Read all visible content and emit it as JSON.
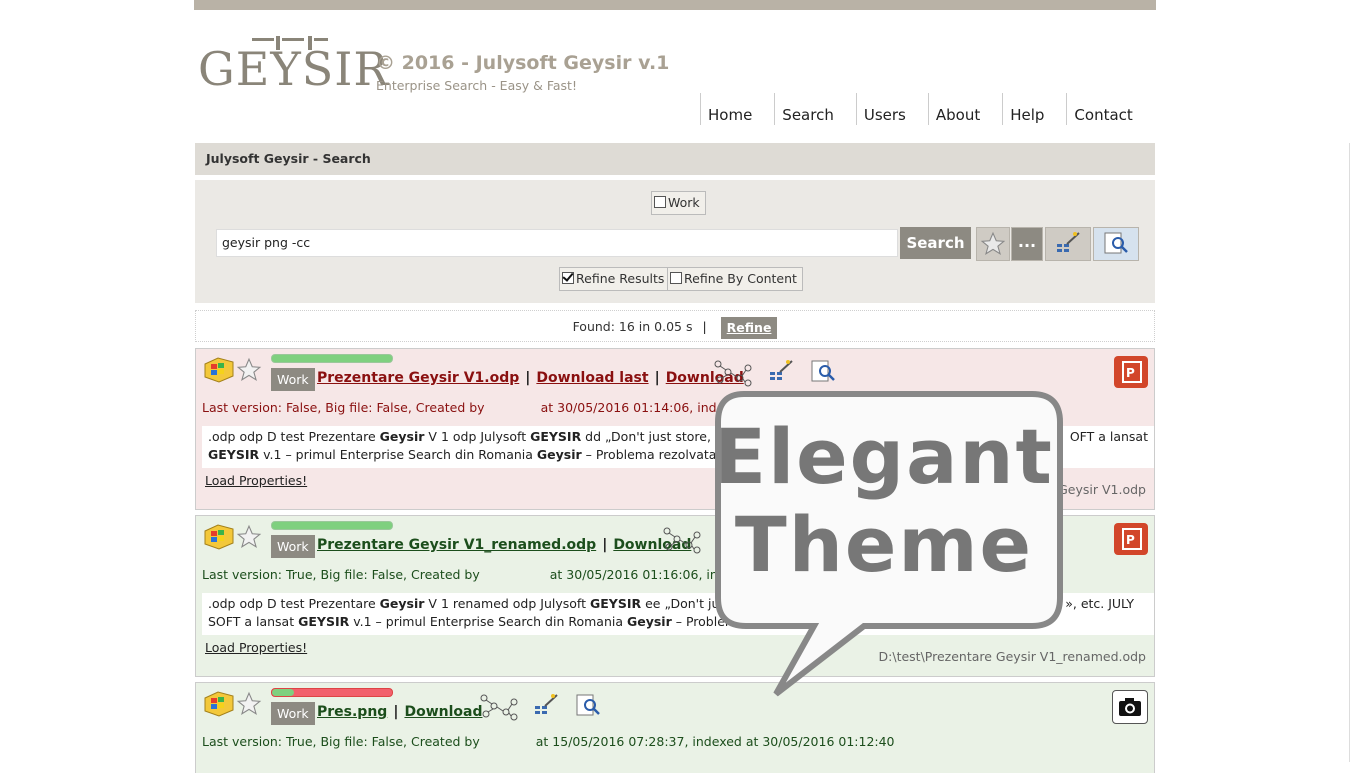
{
  "brand": {
    "logo_text": "GEYSIR",
    "title": "© 2016 - Julysoft Geysir v.1",
    "subtitle": "Enterprise Search - Easy & Fast!"
  },
  "nav": [
    "Home",
    "Search",
    "Users",
    "About",
    "Help",
    "Contact"
  ],
  "breadcrumb": "Julysoft Geysir - Search",
  "search": {
    "scope_label": "Work",
    "scope_checked": false,
    "query": "geysir png -cc",
    "button_label": "Search",
    "more_label": "...",
    "refine_results_label": "Refine Results",
    "refine_results_checked": true,
    "refine_content_label": "Refine By Content",
    "refine_content_checked": false
  },
  "found": {
    "text": "Found: 16 in 0.05 s",
    "refine_label": "Refine"
  },
  "results": [
    {
      "theme": "red",
      "relevance": 1.0,
      "badge": "Work",
      "title": "Prezentare Geysir V1.odp",
      "links": [
        "Download last",
        "Download"
      ],
      "meta_left": "Last version: False, Big file: False, Created by",
      "meta_right": "at 30/05/2016 01:14:06, indexed at",
      "snippet_1a": ".odp odp D test Prezentare ",
      "snippet_1b": "Geysir",
      "snippet_1c": " V 1 odp Julysoft ",
      "snippet_1d": "GEYSIR",
      "snippet_1e": " dd „Don't just store, find!”",
      "snippet_1f": "OFT a lansat",
      "snippet_2a": "GEYSIR",
      "snippet_2b": " v.1 – primul Enterprise Search din Romania ",
      "snippet_2c": "Geysir",
      "snippet_2d": " – Problema rezolvata In m",
      "load_label": "Load Properties!",
      "path": "Geysir V1.odp",
      "filetype": "ppt"
    },
    {
      "theme": "green",
      "relevance": 1.0,
      "badge": "Work",
      "title": "Prezentare Geysir V1_renamed.odp",
      "links": [
        "Download"
      ],
      "meta_left": "Last version: True, Big file: False, Created by",
      "meta_right": "at 30/05/2016 01:16:06, indexed a",
      "snippet_1a": ".odp odp D test Prezentare ",
      "snippet_1b": "Geysir",
      "snippet_1c": " V 1 renamed odp Julysoft ",
      "snippet_1d": "GEYSIR",
      "snippet_1e": " ee „Don't just sto",
      "snippet_1f": "», etc. JULY",
      "snippet_2a": "SOFT a lansat ",
      "snippet_2b": "GEYSIR",
      "snippet_2c": " v.1 – primul Enterprise Search din Romania ",
      "snippet_2d": "Geysir",
      "snippet_2e": " – Problema rez",
      "load_label": "Load Properties!",
      "path": "D:\\test\\Prezentare Geysir V1_renamed.odp",
      "filetype": "ppt"
    },
    {
      "theme": "green",
      "relevance": 0.18,
      "badge": "Work",
      "title": "Pres.png",
      "links": [
        "Download"
      ],
      "meta_left": "Last version: True, Big file: False, Created by",
      "meta_right": "at 15/05/2016 07:28:37, indexed at 30/05/2016 01:12:40",
      "filetype": "image"
    }
  ],
  "callout": {
    "line1": "Elegant",
    "line2": "Theme"
  },
  "colors": {
    "accent": "#8d8a82",
    "red_row": "#f6e7e7",
    "green_row": "#eaf2e6",
    "relevance_good": "#7fd07f",
    "relevance_bad": "#f2606c",
    "ppt": "#d2462a"
  }
}
